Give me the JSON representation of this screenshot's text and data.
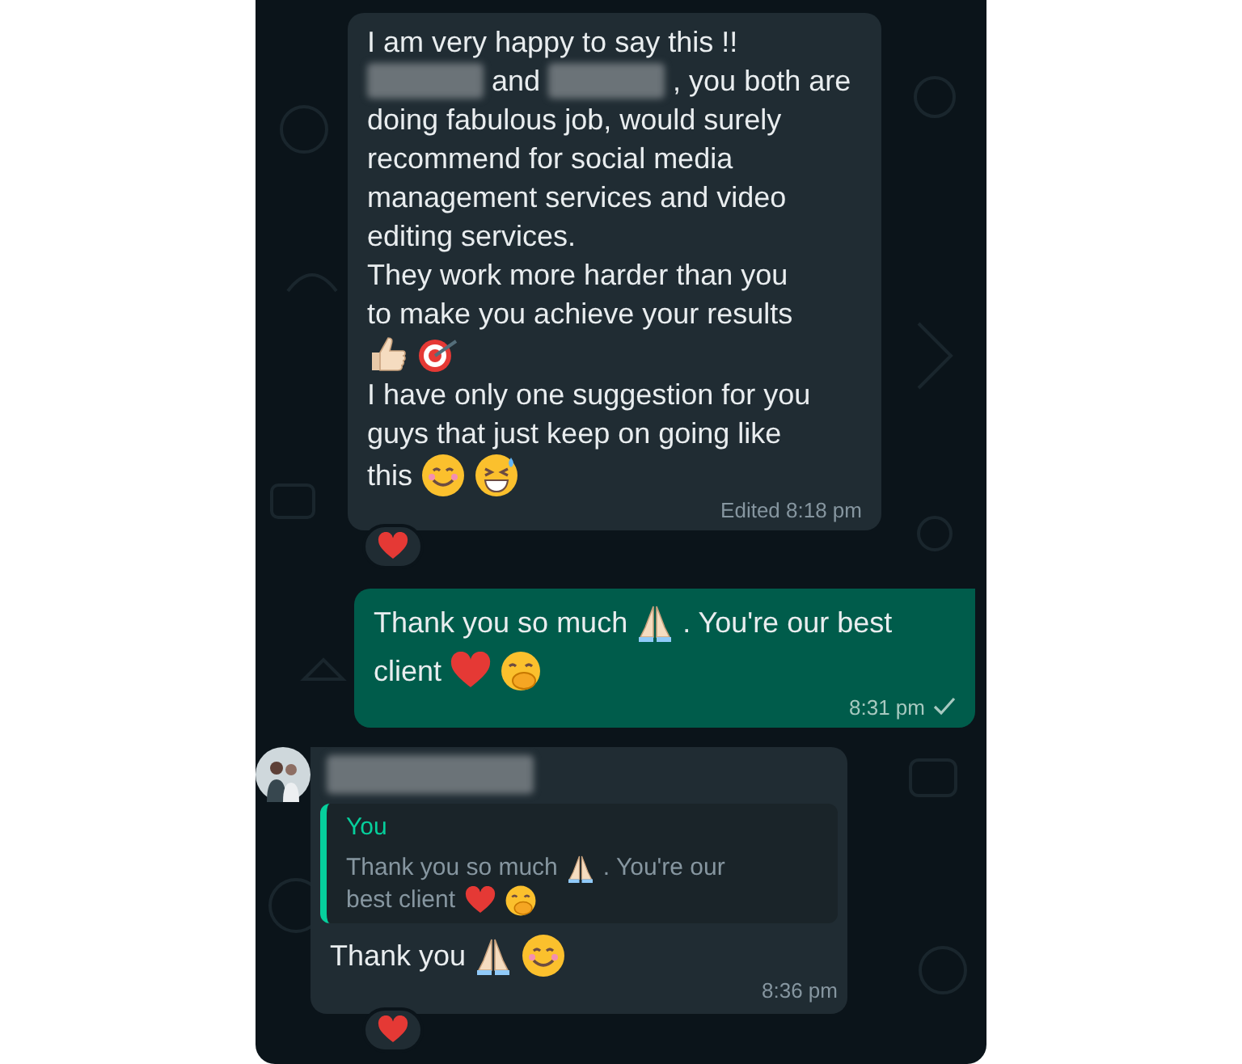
{
  "messages": [
    {
      "kind": "incoming",
      "paragraphs": [
        [
          {
            "kind": "text",
            "text": "I am very happy to say this !!"
          }
        ],
        [
          {
            "kind": "blurred"
          },
          {
            "kind": "text",
            "text": "and"
          },
          {
            "kind": "blurred"
          },
          {
            "kind": "text",
            "text": ", you both are"
          }
        ],
        [
          {
            "kind": "text",
            "text": "doing fabulous job, would surely"
          }
        ],
        [
          {
            "kind": "text",
            "text": "recommend for social media"
          }
        ],
        [
          {
            "kind": "text",
            "text": "management services and video"
          }
        ],
        [
          {
            "kind": "text",
            "text": "editing services."
          }
        ],
        [
          {
            "kind": "text",
            "text": "They work more harder than you"
          }
        ],
        [
          {
            "kind": "text",
            "text": "to make you achieve your results"
          }
        ],
        [
          {
            "kind": "thumbs"
          },
          {
            "kind": "target"
          }
        ],
        [
          {
            "kind": "text",
            "text": "I have only one suggestion for you"
          }
        ],
        [
          {
            "kind": "text",
            "text": "guys that just keep on going like"
          }
        ],
        [
          {
            "kind": "text",
            "text": "this"
          },
          {
            "kind": "smile"
          },
          {
            "kind": "sweat"
          }
        ]
      ],
      "meta": "Edited 8:18 pm",
      "reaction": {
        "kind": "heart"
      }
    },
    {
      "kind": "outgoing",
      "paragraphs": [
        [
          {
            "kind": "text",
            "text": "Thank you so much"
          },
          {
            "kind": "pray"
          },
          {
            "kind": "text",
            "text": ". You're our best"
          }
        ],
        [
          {
            "kind": "text",
            "text": "client"
          },
          {
            "kind": "heart"
          },
          {
            "kind": "giggle"
          }
        ]
      ],
      "meta": "8:31 pm",
      "ticks": true
    },
    {
      "kind": "incoming",
      "avatar": true,
      "sender": {
        "kind": "blurred"
      },
      "quote": {
        "author": "You",
        "paragraphs": [
          [
            {
              "kind": "text",
              "text": "Thank you so much"
            },
            {
              "kind": "pray"
            },
            {
              "kind": "text",
              "text": ". You're our"
            }
          ],
          [
            {
              "kind": "text",
              "text": "best client"
            },
            {
              "kind": "heart"
            },
            {
              "kind": "giggle"
            }
          ]
        ]
      },
      "paragraphs": [
        [
          {
            "kind": "text",
            "text": "Thank you"
          },
          {
            "kind": "pray"
          },
          {
            "kind": "smile"
          }
        ]
      ],
      "meta": "8:36 pm",
      "reaction": {
        "kind": "heart"
      }
    }
  ]
}
